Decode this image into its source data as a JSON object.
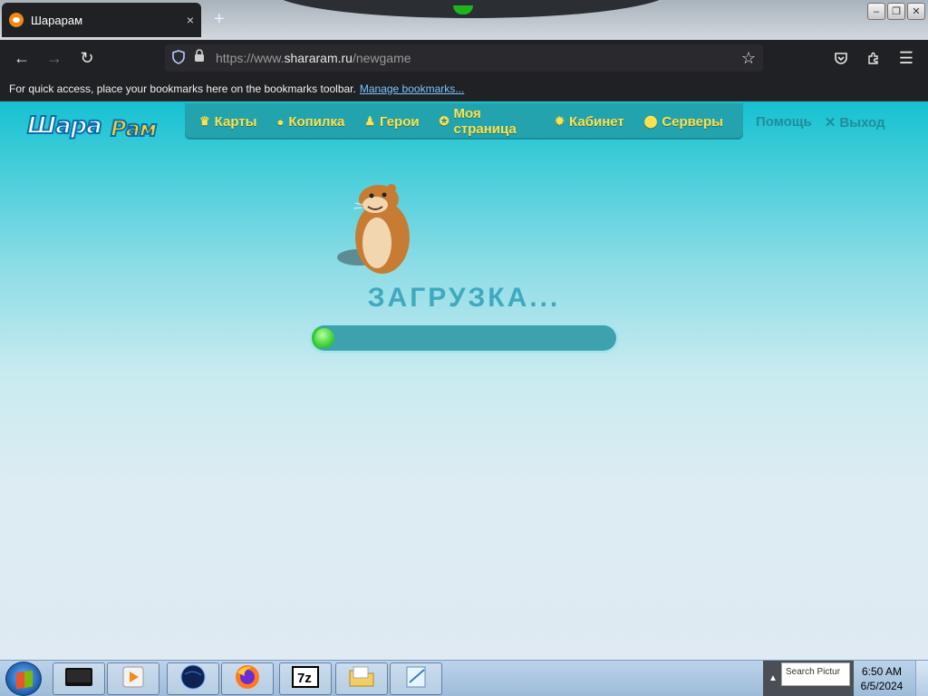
{
  "browser": {
    "tab": {
      "title": "Шарарам",
      "close": "×",
      "favicon": "shararam-favicon"
    },
    "new_tab": "+",
    "window_controls": {
      "minimize": "–",
      "restore": "❐",
      "close": "✕"
    },
    "nav": {
      "back": "←",
      "forward": "→",
      "reload": "↻"
    },
    "url": {
      "prefix": "https://www.",
      "host": "shararam.ru",
      "path": "/newgame"
    },
    "bookmarks_bar": {
      "text": "For quick access, place your bookmarks here on the bookmarks toolbar.",
      "link": "Manage bookmarks..."
    }
  },
  "site": {
    "logo": {
      "part1": "Шара",
      "part2": "Рам"
    },
    "menu": [
      {
        "icon": "crown-icon",
        "glyph": "♛",
        "label": "Карты"
      },
      {
        "icon": "piggy-bank-icon",
        "glyph": "●",
        "label": "Копилка"
      },
      {
        "icon": "hero-icon",
        "glyph": "♟",
        "label": "Герои"
      },
      {
        "icon": "star-icon",
        "glyph": "✪",
        "label": "Моя страница"
      },
      {
        "icon": "gear-icon",
        "glyph": "✹",
        "label": "Кабинет"
      },
      {
        "icon": "location-pin-icon",
        "glyph": "⬤",
        "label": "Серверы"
      }
    ],
    "help": "Помощь",
    "logout": "✕ Выход"
  },
  "loading": {
    "text": "ЗАГРУЗКА...",
    "progress": 0.03
  },
  "taskbar": {
    "apps": [
      "media-center-icon",
      "media-player-icon",
      "globe-icon",
      "firefox-icon",
      "7zip-icon",
      "folder-icon",
      "notepad-icon"
    ],
    "tray_popup": "Search Pictur",
    "time": "6:50 AM",
    "date": "6/5/2024"
  },
  "colors": {
    "accent": "#1f8d9b",
    "menu_text": "#ffe14a",
    "progress_fill": "#38c43b"
  }
}
